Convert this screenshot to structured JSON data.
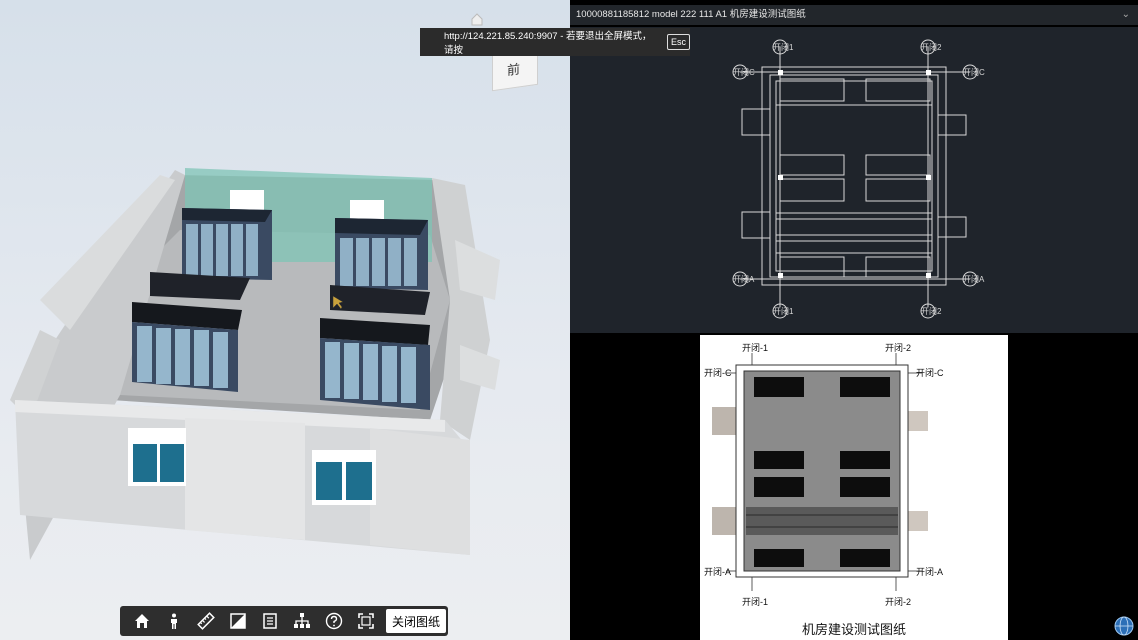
{
  "viewer": {
    "view_cube_label": "前",
    "toolbar": {
      "items": [
        {
          "name": "home-icon"
        },
        {
          "name": "person-icon"
        },
        {
          "name": "ruler-icon"
        },
        {
          "name": "section-icon"
        },
        {
          "name": "document-icon"
        },
        {
          "name": "structure-tree-icon"
        },
        {
          "name": "help-icon"
        },
        {
          "name": "fullscreen-icon"
        }
      ],
      "close_drawing_label": "关闭图纸"
    }
  },
  "fullscreen_toast": {
    "message": "http://124.221.85.240:9907 - 若要退出全屏模式，请按",
    "key": "Esc"
  },
  "drawing_panel": {
    "title": "10000881185812 model 222 111 A1 机房建设测试图纸",
    "cad_labels": {
      "top_left": "开闭1",
      "top_right": "开闭2",
      "left_c": "开闭C",
      "right_c": "开闭C",
      "left_a": "开闭A",
      "right_a": "开闭A",
      "bottom_left": "开闭1",
      "bottom_right": "开闭2"
    },
    "paper_labels": {
      "top_left": "开闭-1",
      "top_right": "开闭-2",
      "left_c": "开闭-C",
      "right_c": "开闭-C",
      "left_a": "开闭-A",
      "right_a": "开闭-A",
      "bottom_left": "开闭-1",
      "bottom_right": "开闭-2"
    },
    "paper_title": "机房建设测试图纸"
  },
  "colors": {
    "toolbar_bg": "#2e2e2e",
    "cad_bg": "#1f242b",
    "accent_glass": "#6fbfb1"
  }
}
